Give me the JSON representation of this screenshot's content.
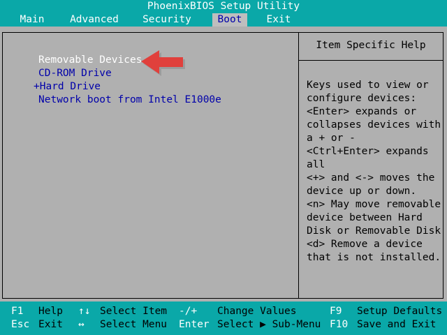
{
  "title": "PhoenixBIOS Setup Utility",
  "tabs": [
    {
      "label": "Main",
      "active": false
    },
    {
      "label": "Advanced",
      "active": false
    },
    {
      "label": "Security",
      "active": false
    },
    {
      "label": "Boot",
      "active": true
    },
    {
      "label": "Exit",
      "active": false
    }
  ],
  "boot_list": [
    {
      "label": "Removable Devices",
      "selected": true
    },
    {
      "label": "CD-ROM Drive",
      "selected": false
    },
    {
      "label": "+Hard Drive",
      "selected": false
    },
    {
      "label": "Network boot from Intel E1000e",
      "selected": false
    }
  ],
  "help": {
    "title": "Item Specific Help",
    "lines": [
      "Keys used to view or",
      "configure devices:",
      "<Enter> expands or",
      "collapses devices with",
      "a + or -",
      "<Ctrl+Enter> expands",
      "all",
      "<+> and <-> moves the",
      "device up or down.",
      "<n> May move removable",
      "device between Hard",
      "Disk or Removable Disk",
      "<d> Remove a device",
      "that is not installed."
    ]
  },
  "footer": {
    "row1": {
      "f1_key": "F1",
      "f1_desc": "Help",
      "arrows_key": "↑↓",
      "arrows_desc": "Select Item",
      "pm_key": "-/+",
      "pm_desc": "Change Values",
      "f9_key": "F9",
      "f9_desc": "Setup Defaults"
    },
    "row2": {
      "esc_key": "Esc",
      "esc_desc": "Exit",
      "lr_key": "↔",
      "lr_desc": "Select Menu",
      "enter_key": "Enter",
      "enter_desc": "Select ▶ Sub-Menu",
      "f10_key": "F10",
      "f10_desc": "Save and Exit"
    }
  },
  "colors": {
    "bar": "#0aa8a8",
    "panel": "#b0b0b0",
    "item_text": "#0000aa",
    "selected_text": "#ffffff",
    "pointer_arrow": "#e0403c"
  },
  "icons": {
    "pointer": "red-arrow-pointer-icon"
  }
}
